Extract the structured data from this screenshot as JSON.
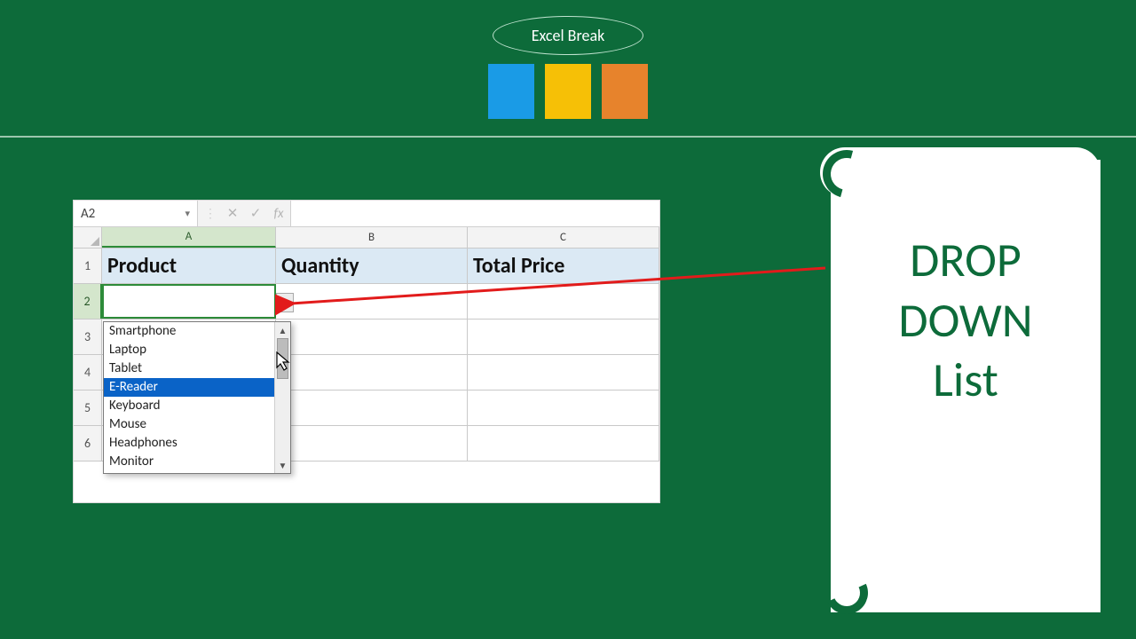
{
  "brand": {
    "name": "Excel Break"
  },
  "annotation": {
    "line1": "DROP",
    "line2": "DOWN",
    "line3": "List"
  },
  "formula_bar": {
    "name_box": "A2",
    "fx_label": "fx",
    "value": ""
  },
  "columns": [
    "A",
    "B",
    "C"
  ],
  "row_numbers": [
    "1",
    "2",
    "3",
    "4",
    "5",
    "6"
  ],
  "table": {
    "headers": {
      "A": "Product",
      "B": "Quantity",
      "C": "Total Price"
    }
  },
  "dropdown": {
    "items": [
      "Smartphone",
      "Laptop",
      "Tablet",
      "E-Reader",
      "Keyboard",
      "Mouse",
      "Headphones",
      "Monitor"
    ],
    "selected_index": 3
  }
}
